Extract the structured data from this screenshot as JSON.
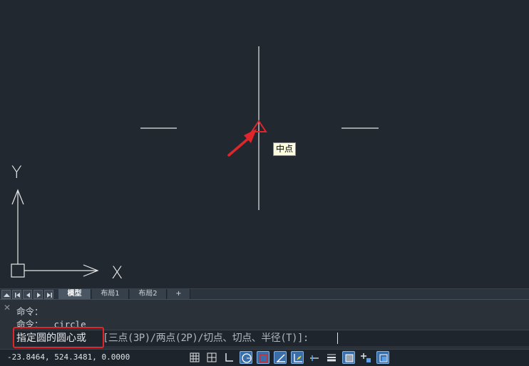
{
  "viewport": {
    "ucs_x_label": "X",
    "ucs_y_label": "Y",
    "snap_tooltip": "中点"
  },
  "tabs": {
    "model": "模型",
    "layout1": "布局1",
    "layout2": "布局2",
    "add": "+"
  },
  "command": {
    "history": [
      "命令：",
      "命令：  circle"
    ],
    "prompt_main": "指定圆的圆心或",
    "prompt_options": "[三点(3P)/两点(2P)/切点、切点、半径(T)]:"
  },
  "status": {
    "coordinates": "-23.8464, 524.3481, 0.0000",
    "buttons": [
      {
        "name": "model-space-grid-icon",
        "on": false
      },
      {
        "name": "grid-display-icon",
        "on": false
      },
      {
        "name": "ortho-mode-icon",
        "on": false
      },
      {
        "name": "polar-tracking-icon",
        "on": true
      },
      {
        "name": "object-snap-icon",
        "on": true
      },
      {
        "name": "object-snap-tracking-icon",
        "on": true
      },
      {
        "name": "dynamic-input-icon",
        "on": true
      },
      {
        "name": "dynamic-ucs-icon",
        "on": false
      },
      {
        "name": "lineweight-icon",
        "on": false
      },
      {
        "name": "transparency-icon",
        "on": true
      },
      {
        "name": "selection-cycling-icon",
        "on": false
      },
      {
        "name": "annotation-monitor-icon",
        "on": true
      }
    ]
  },
  "colors": {
    "canvas": "#212830",
    "snap_marker": "#e0262a",
    "highlight": "#e0262a"
  }
}
